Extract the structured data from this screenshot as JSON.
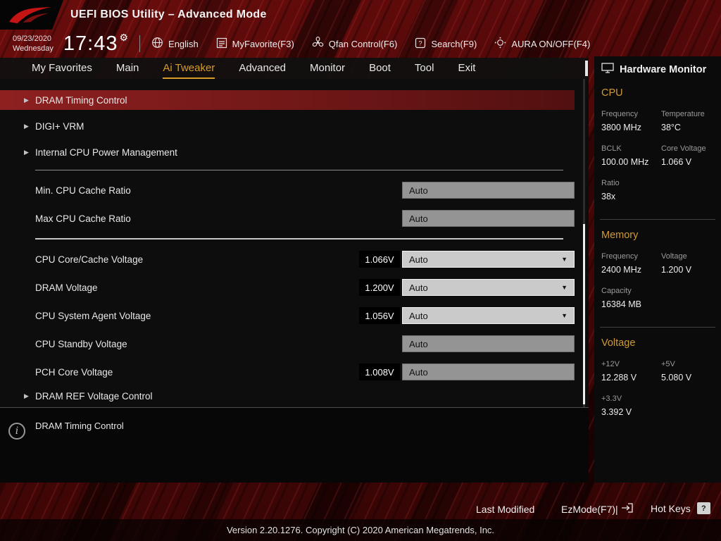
{
  "colors": {
    "accent_orange": "#d79b2a",
    "highlight_red": "#8e2020",
    "panel_black": "#0d0d0d"
  },
  "icon_glyphs": {
    "gear": "⚙",
    "submenu_arrow": "▶",
    "dropdown_caret": "▼",
    "info": "i",
    "question": "?"
  },
  "header": {
    "title": "UEFI BIOS Utility – Advanced Mode",
    "date": "09/23/2020",
    "day": "Wednesday",
    "time": "17:43",
    "toolbar": [
      {
        "icon": "globe-icon",
        "label": "English"
      },
      {
        "icon": "myfavorite-icon",
        "label": "MyFavorite(F3)"
      },
      {
        "icon": "qfan-icon",
        "label": "Qfan Control(F6)"
      },
      {
        "icon": "search-icon",
        "label": "Search(F9)"
      },
      {
        "icon": "aura-icon",
        "label": "AURA ON/OFF(F4)"
      }
    ]
  },
  "nav": {
    "tabs": [
      {
        "label": "My Favorites",
        "active": false
      },
      {
        "label": "Main",
        "active": false
      },
      {
        "label": "Ai Tweaker",
        "active": true
      },
      {
        "label": "Advanced",
        "active": false
      },
      {
        "label": "Monitor",
        "active": false
      },
      {
        "label": "Boot",
        "active": false
      },
      {
        "label": "Tool",
        "active": false
      },
      {
        "label": "Exit",
        "active": false
      }
    ]
  },
  "main": {
    "items": [
      {
        "type": "submenu",
        "label": "DRAM Timing Control",
        "highlighted": true
      },
      {
        "type": "submenu",
        "label": "DIGI+ VRM",
        "highlighted": false
      },
      {
        "type": "submenu",
        "label": "Internal CPU Power Management",
        "highlighted": false
      },
      {
        "type": "setting",
        "label": "Min. CPU Cache Ratio",
        "value": "Auto",
        "control": "box"
      },
      {
        "type": "setting",
        "label": "Max CPU Cache Ratio",
        "value": "Auto",
        "control": "box"
      },
      {
        "type": "setting",
        "label": "CPU Core/Cache Voltage",
        "reading": "1.066V",
        "value": "Auto",
        "control": "dropdown"
      },
      {
        "type": "setting",
        "label": "DRAM Voltage",
        "reading": "1.200V",
        "value": "Auto",
        "control": "dropdown"
      },
      {
        "type": "setting",
        "label": "CPU System Agent Voltage",
        "reading": "1.056V",
        "value": "Auto",
        "control": "dropdown"
      },
      {
        "type": "setting",
        "label": "CPU Standby Voltage",
        "value": "Auto",
        "control": "box"
      },
      {
        "type": "setting",
        "label": "PCH Core Voltage",
        "reading": "1.008V",
        "value": "Auto",
        "control": "box"
      },
      {
        "type": "submenu",
        "label": "DRAM REF Voltage Control",
        "highlighted": false
      }
    ],
    "help_text": "DRAM Timing Control"
  },
  "hardware_monitor": {
    "title": "Hardware Monitor",
    "cpu": {
      "title": "CPU",
      "frequency_label": "Frequency",
      "frequency": "3800 MHz",
      "temperature_label": "Temperature",
      "temperature": "38°C",
      "bclk_label": "BCLK",
      "bclk": "100.00 MHz",
      "core_voltage_label": "Core Voltage",
      "core_voltage": "1.066 V",
      "ratio_label": "Ratio",
      "ratio": "38x"
    },
    "memory": {
      "title": "Memory",
      "frequency_label": "Frequency",
      "frequency": "2400 MHz",
      "voltage_label": "Voltage",
      "voltage": "1.200 V",
      "capacity_label": "Capacity",
      "capacity": "16384 MB"
    },
    "voltage": {
      "title": "Voltage",
      "v12_label": "+12V",
      "v12": "12.288 V",
      "v5_label": "+5V",
      "v5": "5.080 V",
      "v33_label": "+3.3V",
      "v33": "3.392 V"
    }
  },
  "footer": {
    "last_modified": "Last Modified",
    "ezmode": "EzMode(F7)|",
    "hot_keys": "Hot Keys",
    "version": "Version 2.20.1276. Copyright (C) 2020 American Megatrends, Inc."
  }
}
